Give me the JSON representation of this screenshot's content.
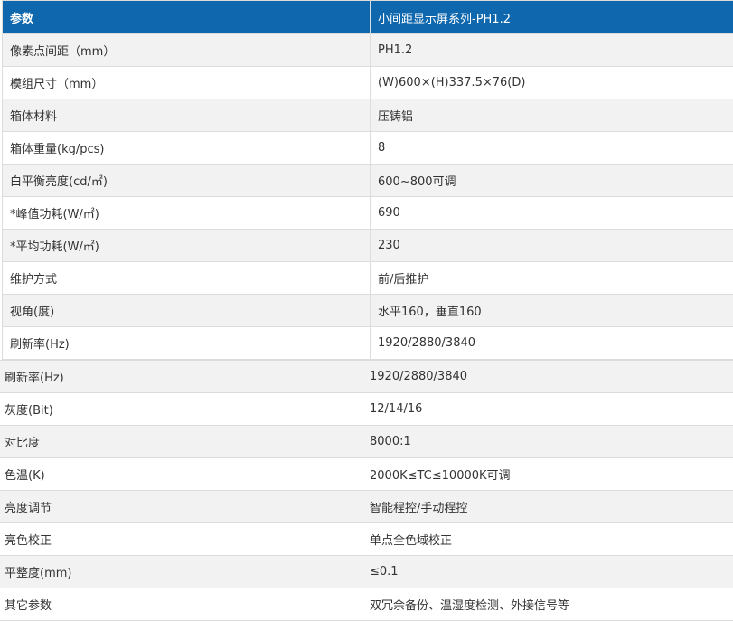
{
  "header": {
    "param_label": "参数",
    "product_title": "小间距显示屏系列-PH1.2"
  },
  "top_rows": [
    {
      "label": "像素点间距（mm）",
      "value": "PH1.2"
    },
    {
      "label": "模组尺寸（mm）",
      "value": "(W)600×(H)337.5×76(D)"
    },
    {
      "label": "箱体材料",
      "value": "压铸铝"
    },
    {
      "label": "箱体重量(kg/pcs)",
      "value": "8"
    },
    {
      "label": "白平衡亮度(cd/㎡)",
      "value": "600~800可调"
    },
    {
      "label": "*峰值功耗(W/㎡)",
      "value": "690"
    },
    {
      "label": "*平均功耗(W/㎡)",
      "value": "230"
    },
    {
      "label": "维护方式",
      "value": "前/后推护"
    },
    {
      "label": "视角(度)",
      "value": "水平160，垂直160"
    },
    {
      "label": "刷新率(Hz)",
      "value": "1920/2880/3840"
    }
  ],
  "bottom_rows": [
    {
      "label": "刷新率(Hz)",
      "value": "1920/2880/3840"
    },
    {
      "label": "灰度(Bit)",
      "value": "12/14/16"
    },
    {
      "label": "对比度",
      "value": "8000:1"
    },
    {
      "label": "色温(K)",
      "value": "2000K≤TC≤10000K可调"
    },
    {
      "label": "亮度调节",
      "value": "智能程控/手动程控"
    },
    {
      "label": "亮色校正",
      "value": "单点全色域校正"
    },
    {
      "label": "平整度(mm)",
      "value": "≤0.1"
    },
    {
      "label": "其它参数",
      "value": "双冗余备份、温湿度检测、外接信号等"
    }
  ],
  "colors": {
    "header_bg": "#0f67ad",
    "header_text": "#ffffff",
    "stripe": "#f2f2f2",
    "border": "#dcdcdc"
  }
}
